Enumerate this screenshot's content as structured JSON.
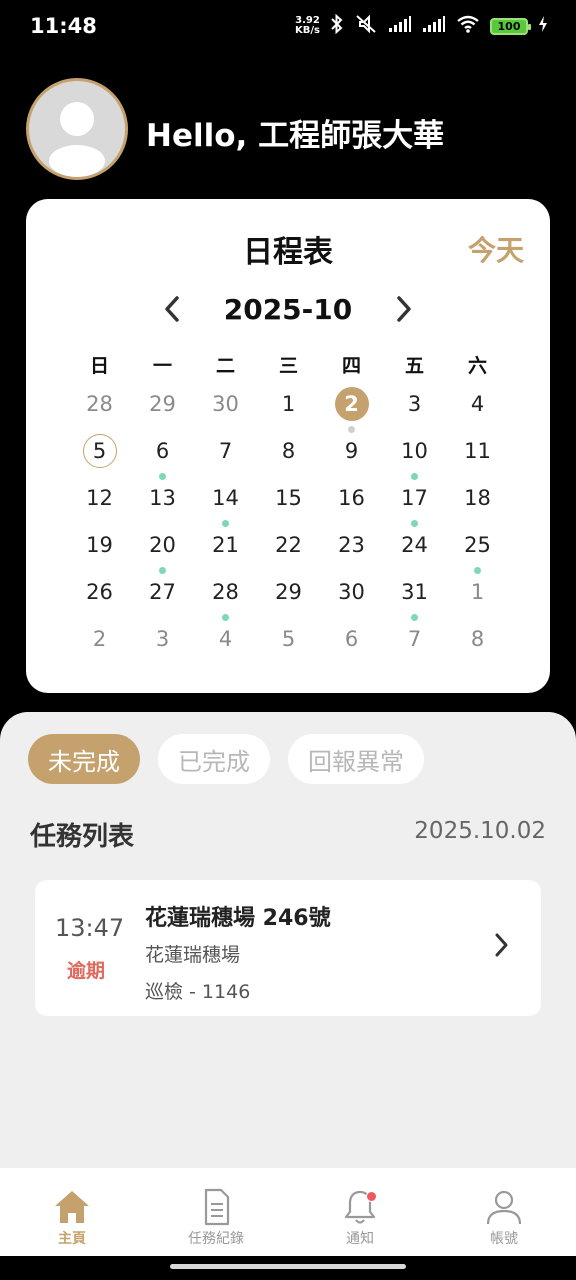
{
  "status_bar": {
    "time": "11:48",
    "net_speed_value": "3.92",
    "net_speed_unit": "KB/s",
    "battery": "100",
    "icons": [
      "bluetooth-icon",
      "mute-icon",
      "signal-icon",
      "signal-icon",
      "wifi-icon",
      "battery-icon",
      "charging-icon"
    ]
  },
  "header": {
    "greeting": "Hello, 工程師張大華",
    "avatar_icon": "user-avatar-icon"
  },
  "calendar": {
    "title": "日程表",
    "today_label": "今天",
    "month_label": "2025-10",
    "prev_icon": "chevron-left-icon",
    "next_icon": "chevron-right-icon",
    "weekdays": [
      "日",
      "一",
      "二",
      "三",
      "四",
      "五",
      "六"
    ],
    "weeks": [
      [
        {
          "d": "28",
          "other": true
        },
        {
          "d": "29",
          "other": true
        },
        {
          "d": "30",
          "other": true
        },
        {
          "d": "1"
        },
        {
          "d": "2",
          "selected": true,
          "dot": "grey"
        },
        {
          "d": "3"
        },
        {
          "d": "4"
        }
      ],
      [
        {
          "d": "5",
          "today": true
        },
        {
          "d": "6",
          "dot": "green"
        },
        {
          "d": "7"
        },
        {
          "d": "8"
        },
        {
          "d": "9"
        },
        {
          "d": "10",
          "dot": "green"
        },
        {
          "d": "11"
        }
      ],
      [
        {
          "d": "12"
        },
        {
          "d": "13"
        },
        {
          "d": "14",
          "dot": "green"
        },
        {
          "d": "15"
        },
        {
          "d": "16"
        },
        {
          "d": "17",
          "dot": "green"
        },
        {
          "d": "18"
        }
      ],
      [
        {
          "d": "19"
        },
        {
          "d": "20",
          "dot": "green"
        },
        {
          "d": "21"
        },
        {
          "d": "22"
        },
        {
          "d": "23"
        },
        {
          "d": "24"
        },
        {
          "d": "25",
          "dot": "green"
        }
      ],
      [
        {
          "d": "26"
        },
        {
          "d": "27"
        },
        {
          "d": "28",
          "dot": "green"
        },
        {
          "d": "29"
        },
        {
          "d": "30"
        },
        {
          "d": "31",
          "dot": "green"
        },
        {
          "d": "1",
          "other": true
        }
      ],
      [
        {
          "d": "2",
          "other": true
        },
        {
          "d": "3",
          "other": true
        },
        {
          "d": "4",
          "other": true
        },
        {
          "d": "5",
          "other": true
        },
        {
          "d": "6",
          "other": true
        },
        {
          "d": "7",
          "other": true
        },
        {
          "d": "8",
          "other": true
        }
      ]
    ]
  },
  "filter_tabs": [
    {
      "label": "未完成",
      "active": true
    },
    {
      "label": "已完成",
      "active": false
    },
    {
      "label": "回報異常",
      "active": false
    }
  ],
  "task_list": {
    "title": "任務列表",
    "date": "2025.10.02",
    "tasks": [
      {
        "time": "13:47",
        "status": "逾期",
        "name": "花蓮瑞穗場 246號",
        "site": "花蓮瑞穗場",
        "type": "巡檢 - 1146"
      }
    ]
  },
  "bottom_nav": [
    {
      "label": "主頁",
      "icon": "home-icon",
      "active": true
    },
    {
      "label": "任務紀錄",
      "icon": "document-icon",
      "active": false
    },
    {
      "label": "通知",
      "icon": "bell-icon",
      "active": false,
      "badge": true
    },
    {
      "label": "帳號",
      "icon": "user-icon",
      "active": false
    }
  ],
  "colors": {
    "accent": "#c5a26d",
    "event_dot": "#7dd9b2",
    "overdue": "#e0695e",
    "badge": "#ee5a5a"
  }
}
